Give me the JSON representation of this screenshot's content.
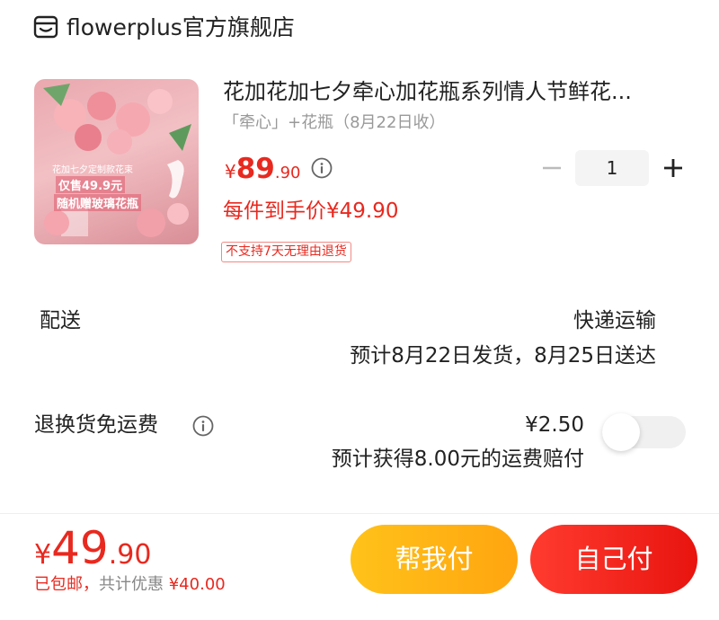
{
  "store": {
    "name": "flowerplus官方旗舰店",
    "icon": "store-icon"
  },
  "product": {
    "title": "花加花加七夕牵心加花瓶系列情人节鲜花...",
    "variant": "「牵心」+花瓶（8月22日收）",
    "image_text_line1": "花加七夕定制款花束",
    "image_text_line2": "仅售49.9元",
    "image_text_line3": "随机赠玻璃花瓶",
    "price_symbol": "¥",
    "price_int": "89",
    "price_dec": ".90",
    "quantity": "1",
    "promo_price": "每件到手价¥49.90",
    "return_tag": "不支持7天无理由退货"
  },
  "delivery": {
    "label": "配送",
    "method": "快递运输",
    "eta": "预计8月22日发货，8月25日送达"
  },
  "return_freight": {
    "label": "退换货免运费",
    "price": "¥2.50",
    "description": "预计获得8.00元的运费赔付",
    "enabled": false
  },
  "checkout": {
    "total_symbol": "¥",
    "total_int": "49",
    "total_dec": ".90",
    "free_shipping": "已包邮，",
    "discount_label": "共计优惠",
    "discount_value": "¥40.00",
    "help_pay_label": "帮我付",
    "self_pay_label": "自己付"
  },
  "colors": {
    "accent_red": "#e8291f",
    "accent_yellow": "#ffb414"
  }
}
